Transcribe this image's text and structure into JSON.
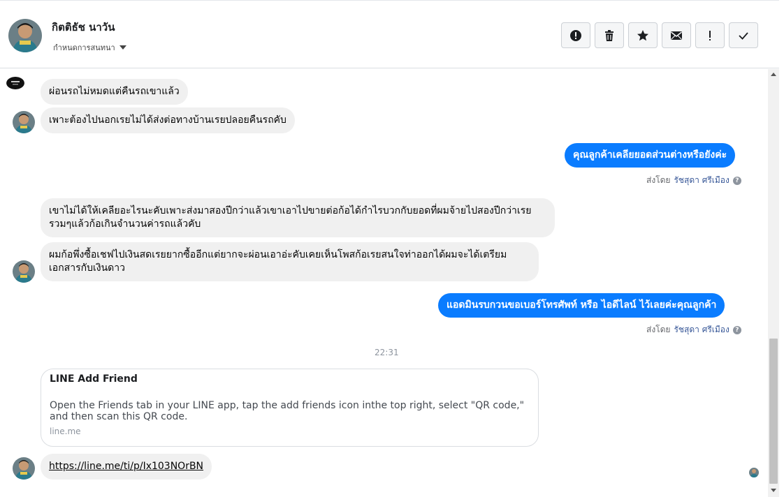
{
  "header": {
    "contact_name": "กิตติธัช นาวัน",
    "assign_label": "กำหนดการสนทนา",
    "actions": [
      {
        "name": "report-button",
        "icon": "alert-icon"
      },
      {
        "name": "delete-button",
        "icon": "trash-icon"
      },
      {
        "name": "star-button",
        "icon": "star-icon"
      },
      {
        "name": "mark-unread-button",
        "icon": "envelope-icon"
      },
      {
        "name": "follow-up-button",
        "icon": "exclamation-icon"
      },
      {
        "name": "done-button",
        "icon": "check-icon"
      }
    ]
  },
  "messages": {
    "m1": "ผ่อนรถไม่หมดแต่คืนรถเขาแล้ว",
    "m2": "เพาะต้องไปนอกเรยไม่ได้ส่งต่อทางบ้านเรยปลอยคืนรถคับ",
    "m3": "คุณลูกค้าเคลียยอดส่วนต่างหรือยังค่ะ",
    "m4": "เขาไม่ได้ให้เคลียอะไรนะคับเพาะส่งมาสองปีกว่าแล้วเขาเอาไปขายต่อก้อได้กำไรบวกกับยอดที่ผมจ้ายไปสองปีกว่าเรยรวมๆแล้วก้อเกินจำนวนค่ารถแล้วคับ",
    "m5": "ผมก้อพึ่งซื้อเชฟไปเงินสดเรยยากซื้ออีกแต่ยากจะผ่อนเอาอ่ะคับเคยเห็นโพสก้อเรยสนใจท่าออกได้ผมจะได้เตรียมเอกสารกับเงินดาว",
    "m6": "แอดมินรบกวนขอเบอร์โทรศัพท์ หรือ ไอดีไลน์  ไว้เลยค่ะคุณลูกค้า",
    "sent_by_prefix": "ส่งโดย",
    "sent_by_name": "รัชสุดา ศรีเมือง",
    "time": "22:31",
    "card": {
      "title": "LINE Add Friend",
      "description": "Open the Friends tab in your LINE app, tap the add friends icon inthe top right, select \"QR code,\" and then scan this QR code.",
      "domain": "line.me"
    },
    "link": "https://line.me/ti/p/Ix103NOrBN"
  },
  "colors": {
    "outgoing_bubble": "#0a7cff",
    "incoming_bubble": "#f0f0f0",
    "agent_name": "#385898"
  }
}
